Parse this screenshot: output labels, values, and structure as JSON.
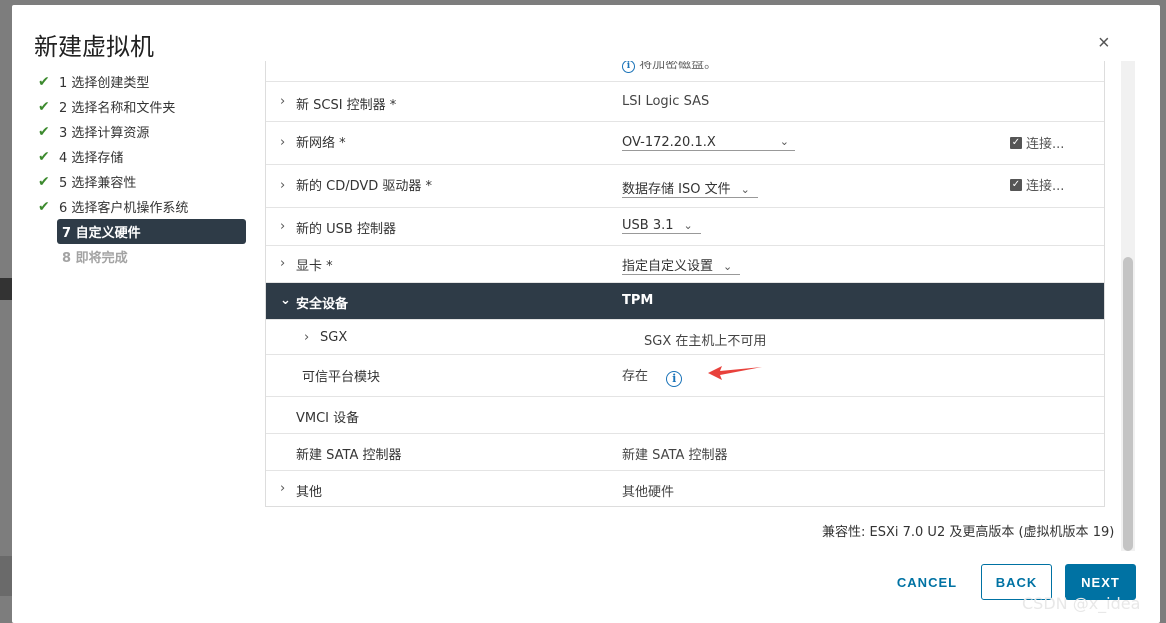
{
  "dialog": {
    "title": "新建虚拟机",
    "close_label": "×"
  },
  "steps": [
    {
      "label": "1 选择创建类型",
      "state": "done"
    },
    {
      "label": "2 选择名称和文件夹",
      "state": "done"
    },
    {
      "label": "3 选择计算资源",
      "state": "done"
    },
    {
      "label": "4 选择存储",
      "state": "done"
    },
    {
      "label": "5 选择兼容性",
      "state": "done"
    },
    {
      "label": "6 选择客户机操作系统",
      "state": "done"
    },
    {
      "label": "7 自定义硬件",
      "state": "active"
    },
    {
      "label": "8 即将完成",
      "state": "future"
    }
  ],
  "check_glyph": "✔",
  "hardware": {
    "top_partial_note": "将加密磁盘。",
    "scsi": {
      "name": "新 SCSI 控制器 *",
      "value": "LSI Logic SAS"
    },
    "network": {
      "name": "新网络 *",
      "value": "OV-172.20.1.X",
      "connect_label": "连接..."
    },
    "cdrom": {
      "name": "新的 CD/DVD 驱动器 *",
      "value": "数据存储 ISO 文件",
      "connect_label": "连接..."
    },
    "usb": {
      "name": "新的 USB 控制器",
      "value": "USB 3.1"
    },
    "video": {
      "name": "显卡 *",
      "value": "指定自定义设置"
    },
    "security": {
      "name": "安全设备",
      "value": "TPM"
    },
    "sgx": {
      "name": "SGX",
      "value": "SGX 在主机上不可用"
    },
    "tpm": {
      "name": "可信平台模块",
      "value": "存在"
    },
    "vmci": {
      "name": "VMCI 设备"
    },
    "sata": {
      "name": "新建 SATA 控制器",
      "value": "新建 SATA 控制器"
    },
    "other": {
      "name": "其他",
      "value": "其他硬件"
    }
  },
  "compatibility": "兼容性: ESXi 7.0 U2 及更高版本 (虚拟机版本 19)",
  "buttons": {
    "cancel": "CANCEL",
    "back": "BACK",
    "next": "NEXT"
  },
  "watermark": "CSDN @x_idea",
  "colors": {
    "primary": "#0072a3",
    "dark_row": "#2e3b47",
    "check": "#3c8a2e",
    "annotation_arrow": "#e8413b"
  }
}
